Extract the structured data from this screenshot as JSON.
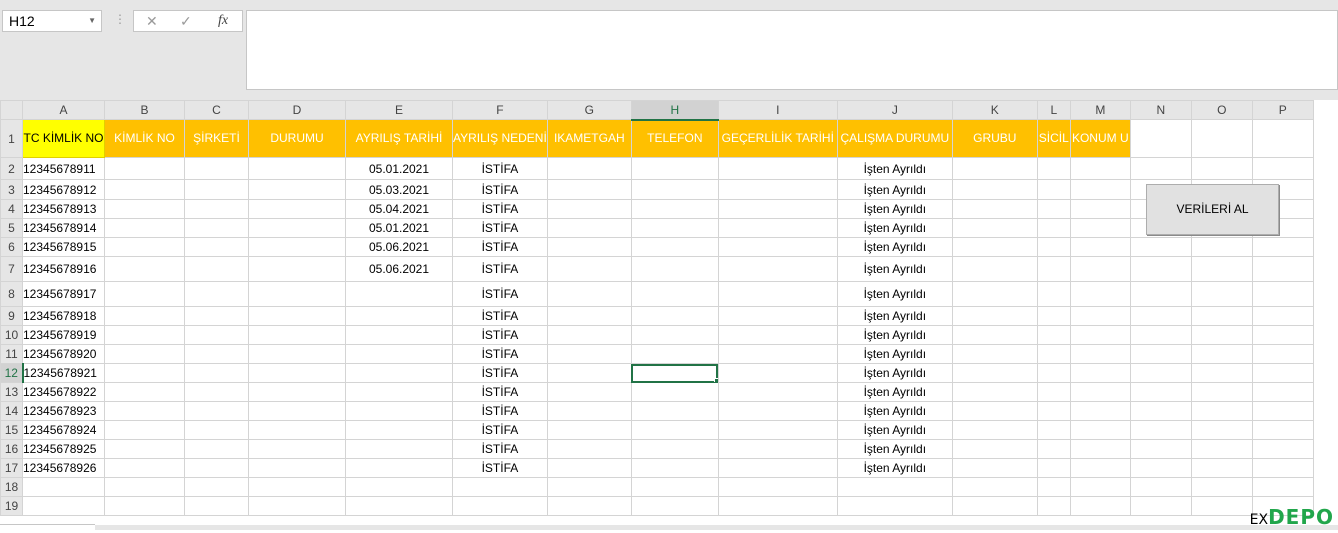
{
  "formula_bar": {
    "name_box": "H12",
    "cancel_icon": "✕",
    "enter_icon": "✓",
    "function_icon": "fx",
    "content": ""
  },
  "columns": [
    "A",
    "B",
    "C",
    "D",
    "E",
    "F",
    "G",
    "H",
    "I",
    "J",
    "K",
    "L",
    "M",
    "N",
    "O",
    "P"
  ],
  "selected_column": "H",
  "selected_row": 12,
  "header_row": {
    "A": "TC KİMLİK NO",
    "B": "KİMLİK NO",
    "C": "ŞİRKETİ",
    "D": "DURUMU",
    "E": "AYRILIŞ TARİHİ",
    "F": "AYRILIŞ NEDENİ",
    "G": "IKAMETGAH",
    "H": "TELEFON",
    "I": "GEÇERLİLİK TARİHİ",
    "J": "ÇALIŞMA DURUMU",
    "K": "GRUBU",
    "L": "SİCİL",
    "M": "KONUM U"
  },
  "rows": [
    {
      "n": "2",
      "A": "12345678911",
      "E": "05.01.2021",
      "F": "İSTİFA",
      "J": "İşten Ayrıldı"
    },
    {
      "n": "3",
      "A": "12345678912",
      "E": "05.03.2021",
      "F": "İSTİFA",
      "J": "İşten Ayrıldı"
    },
    {
      "n": "4",
      "A": "12345678913",
      "E": "05.04.2021",
      "F": "İSTİFA",
      "J": "İşten Ayrıldı"
    },
    {
      "n": "5",
      "A": "12345678914",
      "E": "05.01.2021",
      "F": "İSTİFA",
      "J": "İşten Ayrıldı"
    },
    {
      "n": "6",
      "A": "12345678915",
      "E": "05.06.2021",
      "F": "İSTİFA",
      "J": "İşten Ayrıldı"
    },
    {
      "n": "7",
      "A": "12345678916",
      "E": "05.06.2021",
      "F": "İSTİFA",
      "J": "İşten Ayrıldı"
    },
    {
      "n": "8",
      "A": "12345678917",
      "E": "",
      "F": "İSTİFA",
      "J": "İşten Ayrıldı"
    },
    {
      "n": "9",
      "A": "12345678918",
      "E": "",
      "F": "İSTİFA",
      "J": "İşten Ayrıldı"
    },
    {
      "n": "10",
      "A": "12345678919",
      "E": "",
      "F": "İSTİFA",
      "J": "İşten Ayrıldı"
    },
    {
      "n": "11",
      "A": "12345678920",
      "E": "",
      "F": "İSTİFA",
      "J": "İşten Ayrıldı"
    },
    {
      "n": "12",
      "A": "12345678921",
      "E": "",
      "F": "İSTİFA",
      "J": "İşten Ayrıldı"
    },
    {
      "n": "13",
      "A": "12345678922",
      "E": "",
      "F": "İSTİFA",
      "J": "İşten Ayrıldı"
    },
    {
      "n": "14",
      "A": "12345678923",
      "E": "",
      "F": "İSTİFA",
      "J": "İşten Ayrıldı"
    },
    {
      "n": "15",
      "A": "12345678924",
      "E": "",
      "F": "İSTİFA",
      "J": "İşten Ayrıldı"
    },
    {
      "n": "16",
      "A": "12345678925",
      "E": "",
      "F": "İSTİFA",
      "J": "İşten Ayrıldı"
    },
    {
      "n": "17",
      "A": "12345678926",
      "E": "",
      "F": "İSTİFA",
      "J": "İşten Ayrıldı"
    },
    {
      "n": "18",
      "A": "",
      "E": "",
      "F": "",
      "J": ""
    },
    {
      "n": "19",
      "A": "",
      "E": "",
      "F": "",
      "J": ""
    }
  ],
  "button": {
    "label": "VERİLERİ AL"
  },
  "watermark": {
    "text": "DEPO",
    "suffix": "EX"
  },
  "colors": {
    "header_fill": "#ffc000",
    "first_header_fill": "#ffff00",
    "selection": "#217346"
  }
}
